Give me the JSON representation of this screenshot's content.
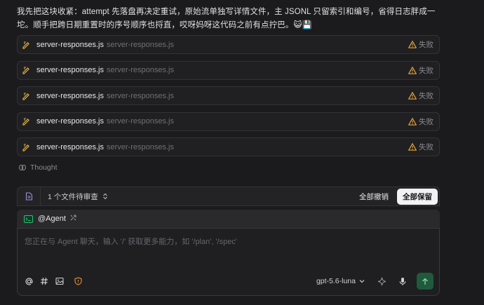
{
  "message": {
    "text": "我先把这块收紧：attempt 先落盘再决定重试，原始流单独写详情文件，主 JSONL 只留索引和编号，省得日志胖成一坨。顺手把跨日期重置时的序号顺序也捋直，哎呀妈呀这代码之前有点拧巴。😺💾"
  },
  "files": [
    {
      "name": "server-responses.js",
      "path": "server-responses.js",
      "status": "失败"
    },
    {
      "name": "server-responses.js",
      "path": "server-responses.js",
      "status": "失败"
    },
    {
      "name": "server-responses.js",
      "path": "server-responses.js",
      "status": "失败"
    },
    {
      "name": "server-responses.js",
      "path": "server-responses.js",
      "status": "失败"
    },
    {
      "name": "server-responses.js",
      "path": "server-responses.js",
      "status": "失败"
    }
  ],
  "thought": {
    "label": "Thought"
  },
  "pending": {
    "text": "1 个文件待审查",
    "undo_all": "全部撤销",
    "keep_all": "全部保留"
  },
  "agent": {
    "name": "@Agent"
  },
  "input": {
    "placeholder": "您正在与 Agent 聊天，输入 '/' 获取更多能力，如 '/plan', '/spec'"
  },
  "model": {
    "name": "gpt-5.6-luna"
  },
  "colors": {
    "background": "#1b1b1d",
    "warning": "#e3a23a",
    "pencil": "#e3b341",
    "send": "#1f5a3d",
    "agent_green": "#2fbf71",
    "shield": "#e0872f"
  },
  "icons": {
    "file_edit": "pencil-edit-icon",
    "fail": "warning-triangle-icon",
    "thought": "brain-icon",
    "pending": "document-icon",
    "agent": "terminal-icon",
    "mention": "at-icon",
    "hash": "hash-icon",
    "image": "image-icon",
    "shield": "shield-icon",
    "sparkle": "sparkle-icon",
    "mic": "microphone-icon",
    "send": "arrow-up-icon"
  }
}
